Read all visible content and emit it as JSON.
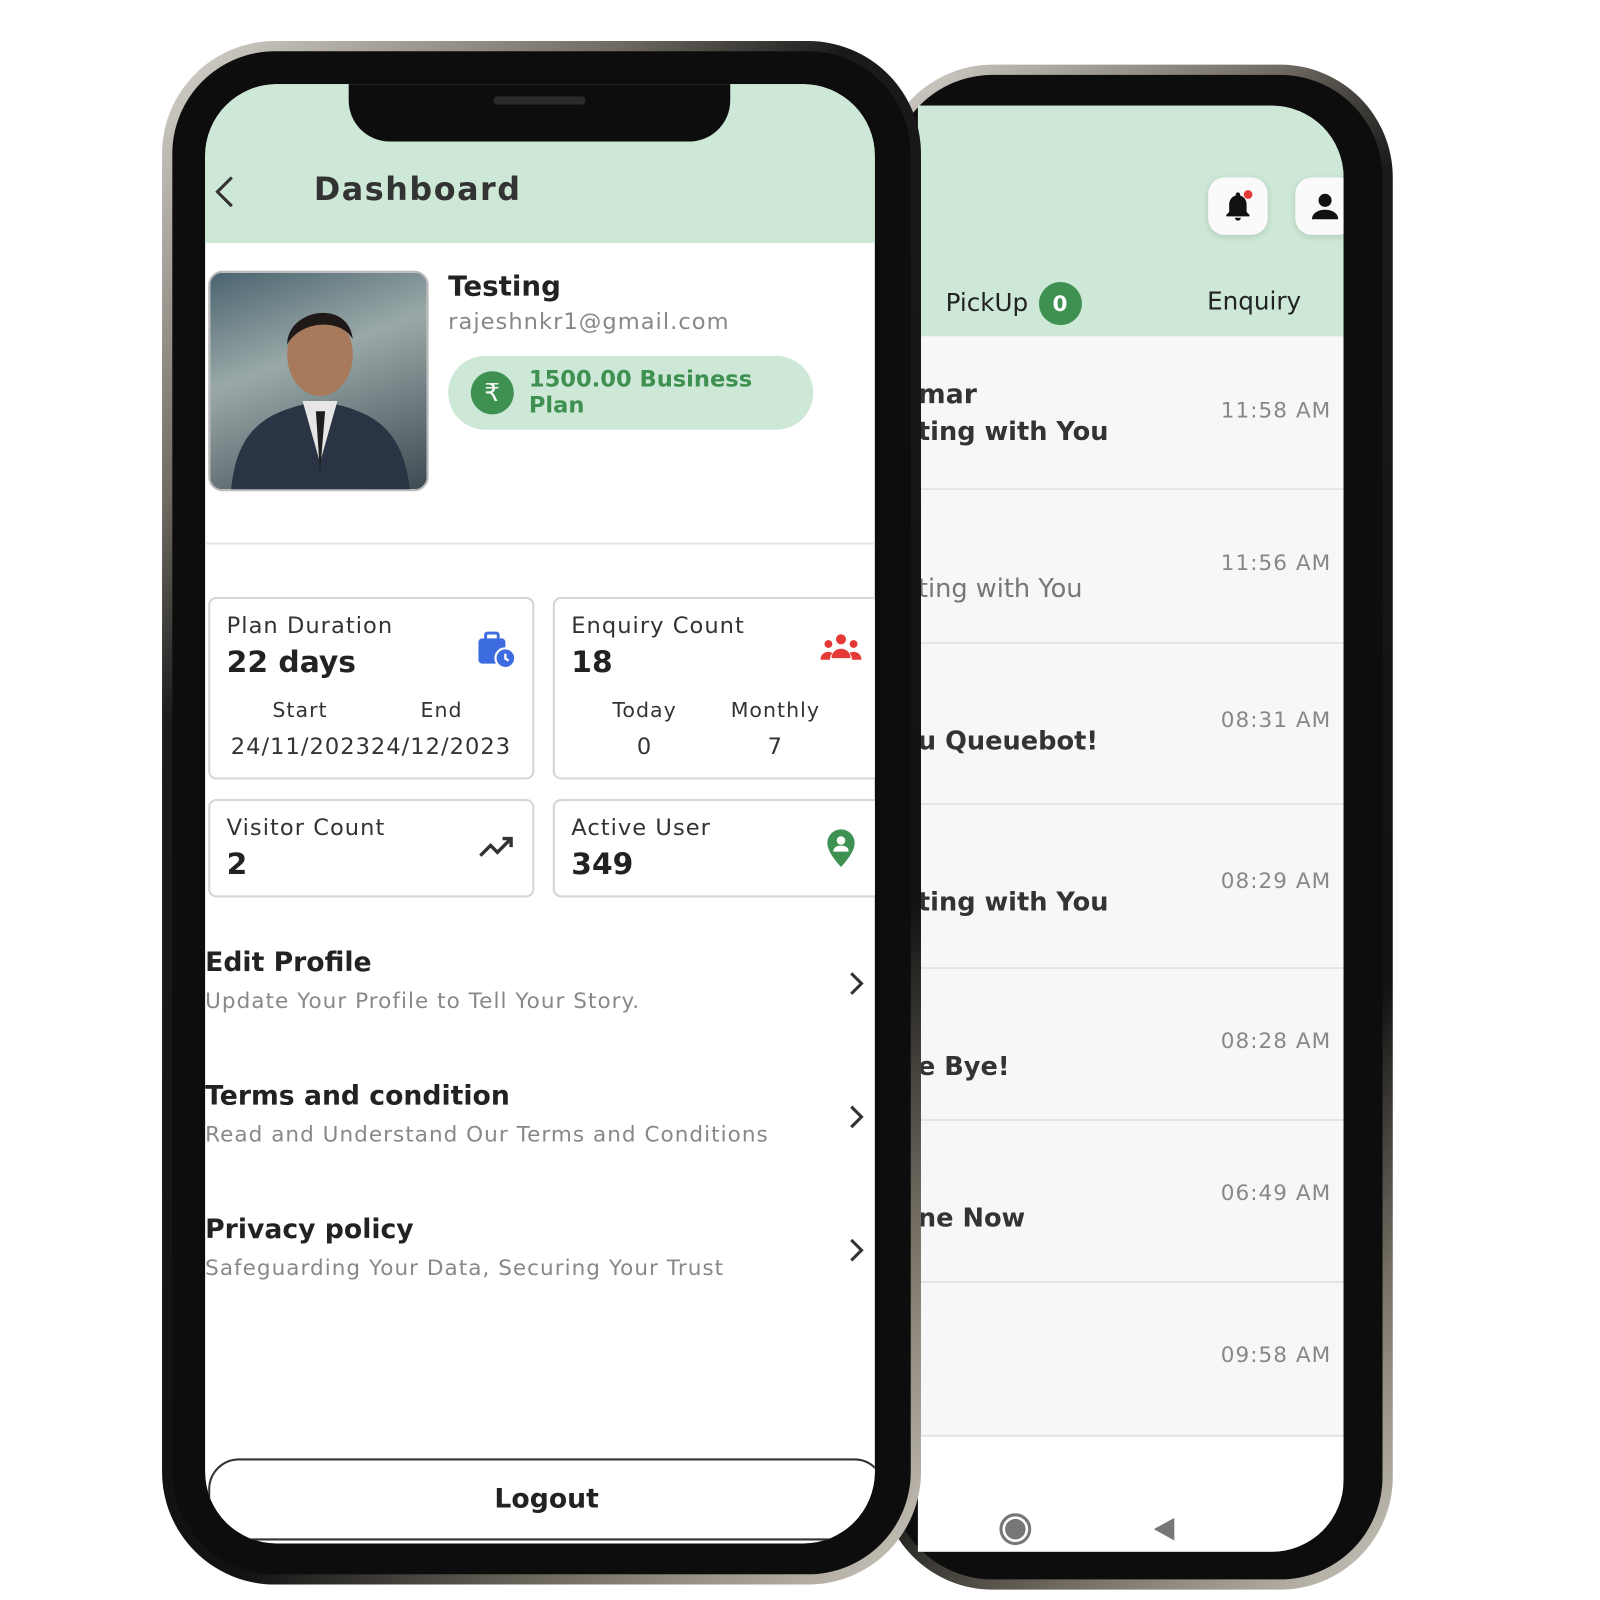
{
  "dashboard": {
    "title": "Dashboard",
    "profile": {
      "name": "Testing",
      "email": "rajeshnkr1@gmail.com",
      "plan": "1500.00 Business Plan",
      "plan_icon": "rupee-icon"
    },
    "cards": {
      "plan_duration": {
        "label": "Plan Duration",
        "value": "22 days",
        "start_label": "Start",
        "end_label": "End",
        "start": "24/11/2023",
        "end": "24/12/2023"
      },
      "enquiry_count": {
        "label": "Enquiry Count",
        "value": "18",
        "today_label": "Today",
        "monthly_label": "Monthly",
        "today": "0",
        "monthly": "7"
      },
      "visitor_count": {
        "label": "Visitor Count",
        "value": "2"
      },
      "active_user": {
        "label": "Active User",
        "value": "349"
      }
    },
    "menu": [
      {
        "title": "Edit Profile",
        "subtitle": "Update Your Profile to Tell Your Story."
      },
      {
        "title": "Terms and condition",
        "subtitle": "Read and Understand Our Terms and Conditions"
      },
      {
        "title": "Privacy policy",
        "subtitle": "Safeguarding Your Data, Securing Your Trust"
      }
    ],
    "logout": "Logout"
  },
  "queue": {
    "tabs": {
      "pickup": "PickUp",
      "pickup_count": "0",
      "enquiry": "Enquiry"
    },
    "items": [
      {
        "line1": "mar",
        "line2": "ting with You",
        "time": "11:58 AM"
      },
      {
        "line1": "",
        "line2": "ting with You",
        "time": "11:56 AM"
      },
      {
        "line1": "",
        "line2": "u Queuebot!",
        "time": "08:31 AM"
      },
      {
        "line1": "",
        "line2": "ting with You",
        "time": "08:29 AM"
      },
      {
        "line1": "",
        "line2": "e Bye!",
        "time": "08:28 AM"
      },
      {
        "line1": "",
        "line2": "ne Now",
        "time": "06:49 AM"
      },
      {
        "line1": "",
        "line2": "",
        "time": "09:58 AM"
      }
    ]
  },
  "colors": {
    "header_bg": "#cde8d7",
    "accent_green": "#3e9150",
    "notification_dot": "#e53935",
    "enquiry_icon": "#e53935",
    "calendar_icon": "#3d6be0"
  }
}
